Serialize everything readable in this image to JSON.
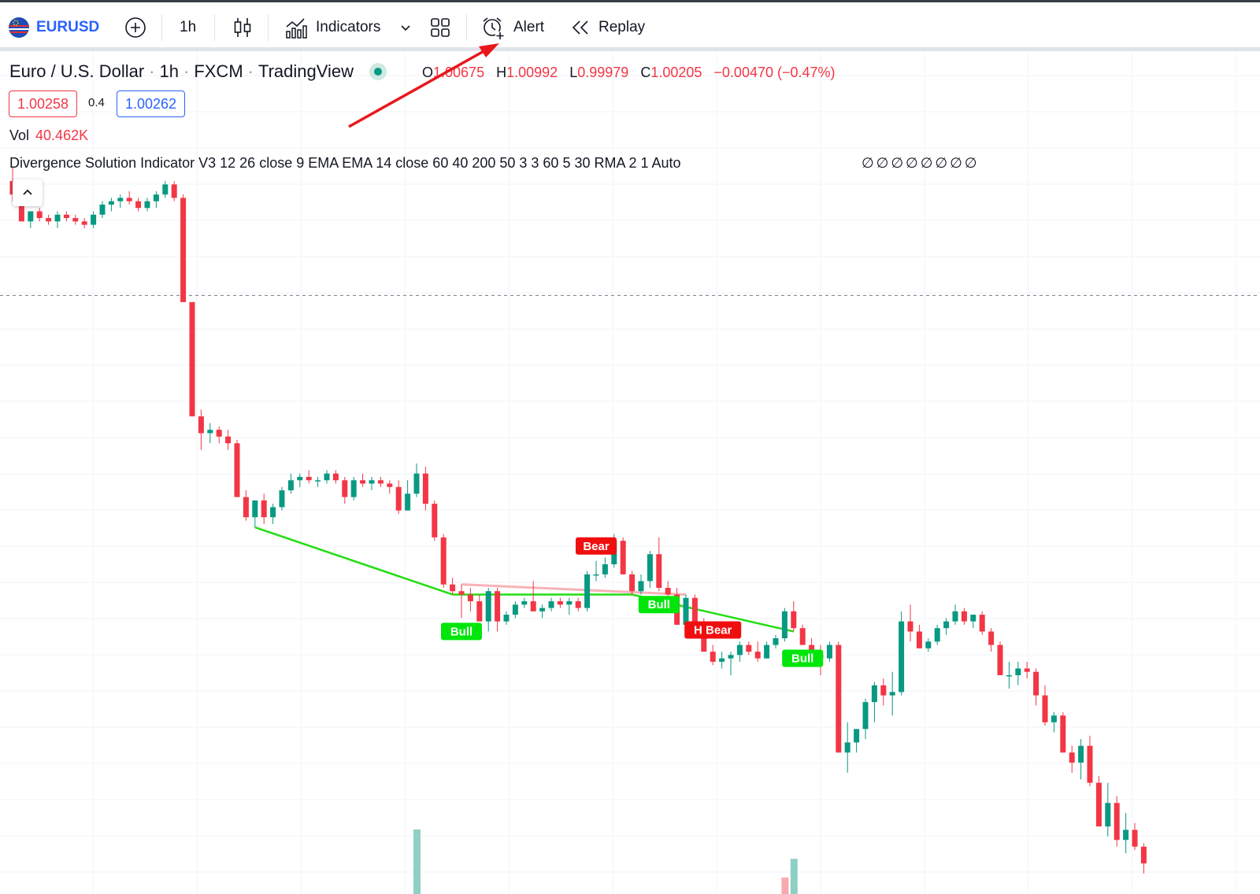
{
  "toolbar": {
    "symbol": "EURUSD",
    "interval": "1h",
    "indicators_label": "Indicators",
    "alert_label": "Alert",
    "replay_label": "Replay"
  },
  "legend": {
    "symbol_name": "Euro / U.S. Dollar",
    "interval": "1h",
    "exchange": "FXCM",
    "source": "TradingView",
    "separator": "·",
    "ohlc": {
      "o_label": "O",
      "o_value": "1.00675",
      "h_label": "H",
      "h_value": "1.00992",
      "l_label": "L",
      "l_value": "0.99979",
      "c_label": "C",
      "c_value": "1.00205",
      "change": "−0.00470 (−0.47%)"
    },
    "bid": "1.00258",
    "spread": "0.4",
    "ask": "1.00262",
    "vol_label": "Vol",
    "vol_value": "40.462K",
    "indicator_text": "Divergence Solution Indicator V3 12 26 close 9 EMA EMA 14 close 60 40 200 50 3 3 60 5 30 RMA 2 1 Auto",
    "indicator_values": "∅∅∅∅∅∅∅∅"
  },
  "signals": {
    "bull_1": "Bull",
    "bear_1": "Bear",
    "bull_2": "Bull",
    "hbear": "H Bear",
    "bull_3": "Bull"
  },
  "colors": {
    "up": "#089981",
    "down": "#f23645",
    "accent": "#2962ff",
    "bull_line": "#22dd11",
    "bear_line": "#f7b3b8",
    "annotation_arrow": "#e8171c"
  },
  "chart_data": {
    "type": "candlestick",
    "note_series": "Euro / U.S. Dollar hourly candles (open, high, low, close)",
    "candles": [
      [
        1.0136,
        1.014,
        1.013,
        1.0132
      ],
      [
        1.0132,
        1.0134,
        1.0125,
        1.0124
      ],
      [
        1.0124,
        1.0127,
        1.0122,
        1.0127
      ],
      [
        1.0127,
        1.0128,
        1.0124,
        1.0125
      ],
      [
        1.0125,
        1.0126,
        1.0123,
        1.0124
      ],
      [
        1.0124,
        1.0127,
        1.0122,
        1.0126
      ],
      [
        1.0126,
        1.0127,
        1.0124,
        1.0125
      ],
      [
        1.0125,
        1.0126,
        1.0123,
        1.0124
      ],
      [
        1.0124,
        1.0125,
        1.0122,
        1.0123
      ],
      [
        1.0123,
        1.0127,
        1.0122,
        1.0126
      ],
      [
        1.0126,
        1.013,
        1.0125,
        1.0129
      ],
      [
        1.0129,
        1.0131,
        1.0127,
        1.013
      ],
      [
        1.013,
        1.0132,
        1.0128,
        1.0131
      ],
      [
        1.0131,
        1.0133,
        1.0129,
        1.013
      ],
      [
        1.013,
        1.0131,
        1.0127,
        1.0128
      ],
      [
        1.0128,
        1.0131,
        1.0127,
        1.013
      ],
      [
        1.013,
        1.0133,
        1.0128,
        1.0132
      ],
      [
        1.0132,
        1.0136,
        1.0131,
        1.0135
      ],
      [
        1.0135,
        1.0136,
        1.013,
        1.0131
      ],
      [
        1.0131,
        1.0132,
        1.01,
        1.01
      ],
      [
        1.01,
        1.01,
        1.0066,
        1.0066
      ],
      [
        1.0066,
        1.0068,
        1.0056,
        1.0061
      ],
      [
        1.0061,
        1.0064,
        1.0058,
        1.0062
      ],
      [
        1.0062,
        1.0063,
        1.0058,
        1.006
      ],
      [
        1.006,
        1.0062,
        1.0056,
        1.0058
      ],
      [
        1.0058,
        1.0059,
        1.0042,
        1.0042
      ],
      [
        1.0042,
        1.0044,
        1.0035,
        1.0036
      ],
      [
        1.0036,
        1.0041,
        1.0033,
        1.0041
      ],
      [
        1.0041,
        1.0043,
        1.0034,
        1.0036
      ],
      [
        1.0036,
        1.004,
        1.0034,
        1.0039
      ],
      [
        1.0039,
        1.0045,
        1.0038,
        1.0044
      ],
      [
        1.0044,
        1.0049,
        1.0043,
        1.0047
      ],
      [
        1.0047,
        1.0049,
        1.0045,
        1.0048
      ],
      [
        1.0048,
        1.005,
        1.0046,
        1.0047
      ],
      [
        1.0047,
        1.0048,
        1.0045,
        1.0047
      ],
      [
        1.0047,
        1.005,
        1.0046,
        1.0049
      ],
      [
        1.0049,
        1.005,
        1.0046,
        1.0047
      ],
      [
        1.0047,
        1.0048,
        1.004,
        1.0042
      ],
      [
        1.0042,
        1.0048,
        1.0041,
        1.0047
      ],
      [
        1.0047,
        1.0049,
        1.0045,
        1.0046
      ],
      [
        1.0046,
        1.0048,
        1.0044,
        1.0047
      ],
      [
        1.0047,
        1.0048,
        1.0045,
        1.0046
      ],
      [
        1.0046,
        1.0047,
        1.0043,
        1.0045
      ],
      [
        1.0045,
        1.0047,
        1.0037,
        1.0038
      ],
      [
        1.0038,
        1.0047,
        1.0038,
        1.0043
      ],
      [
        1.0043,
        1.0052,
        1.0042,
        1.0049
      ],
      [
        1.0049,
        1.0051,
        1.0038,
        1.004
      ],
      [
        1.004,
        1.0041,
        1.0029,
        1.003
      ],
      [
        1.003,
        1.0031,
        1.0015,
        1.0016
      ],
      [
        1.0016,
        1.0018,
        1.0013,
        1.0014
      ],
      [
        1.0014,
        1.0016,
        1.0006,
        1.0013
      ],
      [
        1.0013,
        1.0015,
        1.0008,
        1.0011
      ],
      [
        1.0011,
        1.0013,
        1.0005,
        1.0005
      ],
      [
        1.0005,
        1.0015,
        1.0002,
        1.0014
      ],
      [
        1.0014,
        1.0015,
        1.0002,
        1.0005
      ],
      [
        1.0005,
        1.0008,
        1.0004,
        1.0007
      ],
      [
        1.0007,
        1.0011,
        1.0006,
        1.001
      ],
      [
        1.001,
        1.0012,
        1.0009,
        1.0011
      ],
      [
        1.0011,
        1.0017,
        1.0008,
        1.0008
      ],
      [
        1.0008,
        1.001,
        1.0006,
        1.0009
      ],
      [
        1.0009,
        1.0012,
        1.0008,
        1.0011
      ],
      [
        1.0011,
        1.0012,
        1.0009,
        1.001
      ],
      [
        1.001,
        1.0012,
        1.0007,
        1.0011
      ],
      [
        1.0011,
        1.0012,
        1.0008,
        1.0009
      ],
      [
        1.0009,
        1.002,
        1.0008,
        1.0019
      ],
      [
        1.0019,
        1.0023,
        1.0017,
        1.0019
      ],
      [
        1.0019,
        1.0024,
        1.0018,
        1.0022
      ],
      [
        1.0022,
        1.0031,
        1.0021,
        1.0029
      ],
      [
        1.0029,
        1.003,
        1.0019,
        1.0019
      ],
      [
        1.0019,
        1.002,
        1.0013,
        1.0014
      ],
      [
        1.0014,
        1.0019,
        1.0013,
        1.0017
      ],
      [
        1.0017,
        1.0026,
        1.0015,
        1.0025
      ],
      [
        1.0025,
        1.003,
        1.0014,
        1.0015
      ],
      [
        1.0015,
        1.0017,
        1.0012,
        1.0013
      ],
      [
        1.0013,
        1.0015,
        1.0006,
        1.0004
      ],
      [
        1.0004,
        1.0013,
        1.0001,
        1.0012
      ],
      [
        1.0012,
        1.0013,
        1.0002,
        1.0003
      ],
      [
        1.0003,
        1.0006,
        0.9996,
        0.9996
      ],
      [
        0.9996,
        0.9998,
        0.9992,
        0.9993
      ],
      [
        0.9993,
        0.9996,
        0.9991,
        0.9994
      ],
      [
        0.9994,
        0.9996,
        0.9989,
        0.9995
      ],
      [
        0.9995,
        0.9999,
        0.9993,
        0.9998
      ],
      [
        0.9998,
        0.9999,
        0.9995,
        0.9996
      ],
      [
        0.9996,
        0.9999,
        0.9993,
        0.9994
      ],
      [
        0.9994,
        0.9999,
        0.9994,
        0.9998
      ],
      [
        0.9998,
        1.0001,
        0.9997,
        1.0
      ],
      [
        1.0,
        1.0009,
        0.9999,
        1.0008
      ],
      [
        1.0008,
        1.0011,
        1.0002,
        1.0003
      ],
      [
        1.0003,
        1.0004,
        0.9998,
        0.9998
      ],
      [
        0.9998,
        1.0,
        0.9993,
        0.9995
      ],
      [
        0.9995,
        0.9998,
        0.9989,
        0.9994
      ],
      [
        0.9994,
        0.9999,
        0.9993,
        0.9998
      ],
      [
        0.9998,
        0.9999,
        0.9966,
        0.9966
      ],
      [
        0.9966,
        0.9975,
        0.996,
        0.9969
      ],
      [
        0.9969,
        0.9973,
        0.9966,
        0.9973
      ],
      [
        0.9973,
        0.9982,
        0.997,
        0.9981
      ],
      [
        0.9981,
        0.9987,
        0.9975,
        0.9986
      ],
      [
        0.9986,
        0.9988,
        0.998,
        0.9983
      ],
      [
        0.9983,
        0.999,
        0.9977,
        0.9984
      ],
      [
        0.9984,
        1.0008,
        0.9983,
        1.0005
      ],
      [
        1.0005,
        1.001,
        0.9999,
        1.0002
      ],
      [
        1.0002,
        1.0004,
        0.9997,
        0.9997
      ],
      [
        0.9997,
        1.0,
        0.9996,
        0.9999
      ],
      [
        0.9999,
        1.0004,
        0.9998,
        1.0003
      ],
      [
        1.0003,
        1.0006,
        1.0001,
        1.0005
      ],
      [
        1.0005,
        1.001,
        1.0004,
        1.0008
      ],
      [
        1.0008,
        1.0009,
        1.0004,
        1.0005
      ],
      [
        1.0005,
        1.0007,
        1.0003,
        1.0007
      ],
      [
        1.0007,
        1.0008,
        1.0001,
        1.0002
      ],
      [
        1.0002,
        1.0003,
        0.9996,
        0.9998
      ],
      [
        0.9998,
        0.9999,
        0.9989,
        0.9989
      ],
      [
        0.9989,
        0.9993,
        0.9985,
        0.9989
      ],
      [
        0.9989,
        0.9993,
        0.9986,
        0.9991
      ],
      [
        0.9991,
        0.9993,
        0.9988,
        0.999
      ],
      [
        0.999,
        0.9991,
        0.998,
        0.9983
      ],
      [
        0.9983,
        0.9986,
        0.9974,
        0.9975
      ],
      [
        0.9975,
        0.9978,
        0.9972,
        0.9977
      ],
      [
        0.9977,
        0.9978,
        0.9966,
        0.9966
      ],
      [
        0.9966,
        0.9968,
        0.996,
        0.9963
      ],
      [
        0.9963,
        0.997,
        0.9958,
        0.9968
      ],
      [
        0.9968,
        0.9971,
        0.9956,
        0.9957
      ],
      [
        0.9957,
        0.9959,
        0.9944,
        0.9944
      ],
      [
        0.9944,
        0.9957,
        0.9941,
        0.9951
      ],
      [
        0.9951,
        0.9953,
        0.9938,
        0.994
      ],
      [
        0.994,
        0.9948,
        0.9936,
        0.9943
      ],
      [
        0.9943,
        0.9945,
        0.9937,
        0.9938
      ],
      [
        0.9938,
        0.9939,
        0.993,
        0.9933
      ]
    ],
    "divergence_lines": [
      {
        "kind": "bull",
        "from_index": 27,
        "to_index": 49
      },
      {
        "kind": "bull",
        "from_index": 49,
        "to_index": 69
      },
      {
        "kind": "bull",
        "from_index": 69,
        "to_index": 87
      },
      {
        "kind": "bear",
        "from_index": 50,
        "to_index": 75
      }
    ],
    "signals": [
      {
        "text_key": "bull_1",
        "index": 50
      },
      {
        "text_key": "bear_1",
        "index": 65
      },
      {
        "text_key": "bull_2",
        "index": 72
      },
      {
        "text_key": "hbear",
        "index": 78
      },
      {
        "text_key": "bull_3",
        "index": 88
      }
    ],
    "volume_bars": [
      {
        "index": 45,
        "value": 55000,
        "color": "up"
      },
      {
        "index": 87,
        "value": 30000,
        "color": "up"
      },
      {
        "index": 86,
        "value": 14000,
        "color": "down"
      }
    ],
    "ylim": [
      0.993,
      1.014
    ],
    "current_price_line": 1.0102,
    "grid": true
  }
}
